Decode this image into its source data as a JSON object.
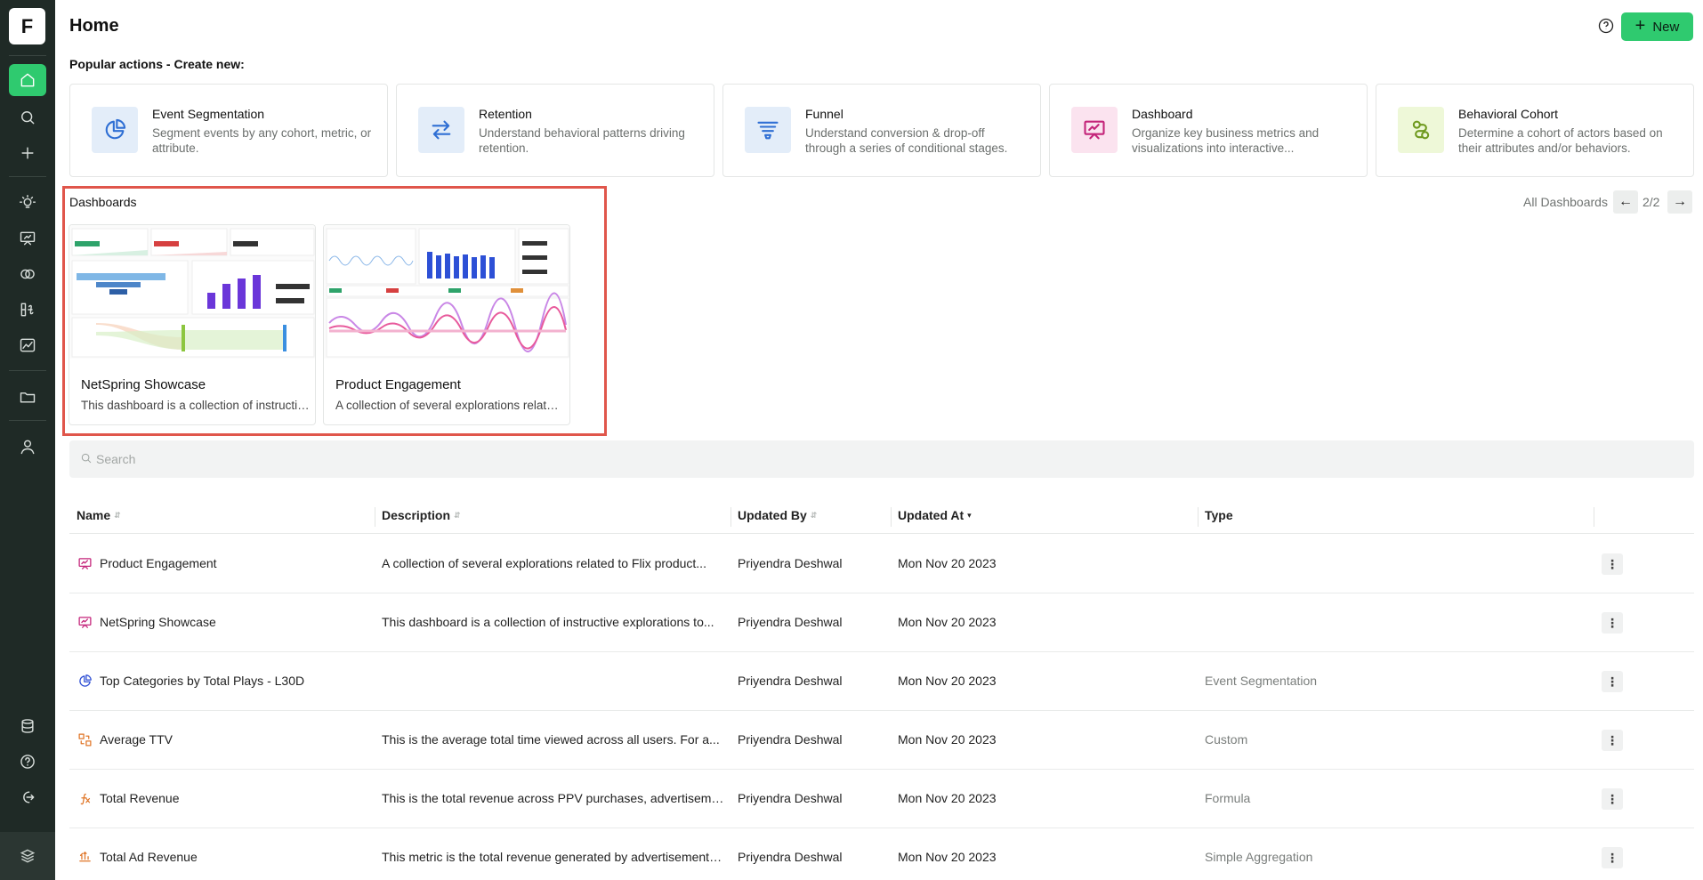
{
  "app": {
    "logo_letter": "F"
  },
  "header": {
    "title": "Home",
    "new_label": "New",
    "new_plus": "+"
  },
  "popular": {
    "label": "Popular actions - Create new:",
    "cards": [
      {
        "title": "Event Segmentation",
        "desc": "Segment events by any cohort, metric, or attribute.",
        "icon": "pie-chart-icon",
        "bg": "#e3edf9",
        "color": "#2f6fd4"
      },
      {
        "title": "Retention",
        "desc": "Understand behavioral patterns driving retention.",
        "icon": "arrows-swap-icon",
        "bg": "#e3edf9",
        "color": "#2f6fd4"
      },
      {
        "title": "Funnel",
        "desc": "Understand conversion & drop-off through a series of conditional stages.",
        "icon": "funnel-icon",
        "bg": "#e3edf9",
        "color": "#2f6fd4"
      },
      {
        "title": "Dashboard",
        "desc": "Organize key business metrics and visualizations into interactive...",
        "icon": "presentation-icon",
        "bg": "#fbe3ef",
        "color": "#c4247a"
      },
      {
        "title": "Behavioral Cohort",
        "desc": "Determine a cohort of actors based on their attributes and/or behaviors.",
        "icon": "cohort-icon",
        "bg": "#eef8d8",
        "color": "#6f9a1f"
      }
    ]
  },
  "dashboards": {
    "label": "Dashboards",
    "all_label": "All Dashboards",
    "pager": "2/2",
    "items": [
      {
        "title": "NetSpring Showcase",
        "desc": "This dashboard is a collection of instructive explorations to..."
      },
      {
        "title": "Product Engagement",
        "desc": "A collection of several explorations related to Flix product..."
      }
    ]
  },
  "search": {
    "placeholder": "Search"
  },
  "table": {
    "columns": [
      "Name",
      "Description",
      "Updated By",
      "Updated At",
      "Type"
    ],
    "rows": [
      {
        "name": "Product Engagement",
        "desc": "A collection of several explorations related to Flix product...",
        "by": "Priyendra Deshwal",
        "at": "Mon Nov 20 2023",
        "type": "",
        "icon": "dashboard-icon"
      },
      {
        "name": "NetSpring Showcase",
        "desc": "This dashboard is a collection of instructive explorations to...",
        "by": "Priyendra Deshwal",
        "at": "Mon Nov 20 2023",
        "type": "",
        "icon": "dashboard-icon"
      },
      {
        "name": "Top Categories by Total Plays - L30D",
        "desc": "",
        "by": "Priyendra Deshwal",
        "at": "Mon Nov 20 2023",
        "type": "Event Segmentation",
        "icon": "pie-chart-icon"
      },
      {
        "name": "Average TTV",
        "desc": "This is the average total time viewed across all users. For a...",
        "by": "Priyendra Deshwal",
        "at": "Mon Nov 20 2023",
        "type": "Custom",
        "icon": "custom-metric-icon"
      },
      {
        "name": "Total Revenue",
        "desc": "This is the total revenue across PPV purchases, advertisement...",
        "by": "Priyendra Deshwal",
        "at": "Mon Nov 20 2023",
        "type": "Formula",
        "icon": "formula-icon"
      },
      {
        "name": "Total Ad Revenue",
        "desc": "This metric is the total revenue generated by advertisements ...",
        "by": "Priyendra Deshwal",
        "at": "Mon Nov 20 2023",
        "type": "Simple Aggregation",
        "icon": "aggregation-icon"
      }
    ]
  },
  "colors": {
    "accent": "#2fca6f",
    "sidebar": "#1f2a26",
    "highlight": "#e0564b"
  }
}
